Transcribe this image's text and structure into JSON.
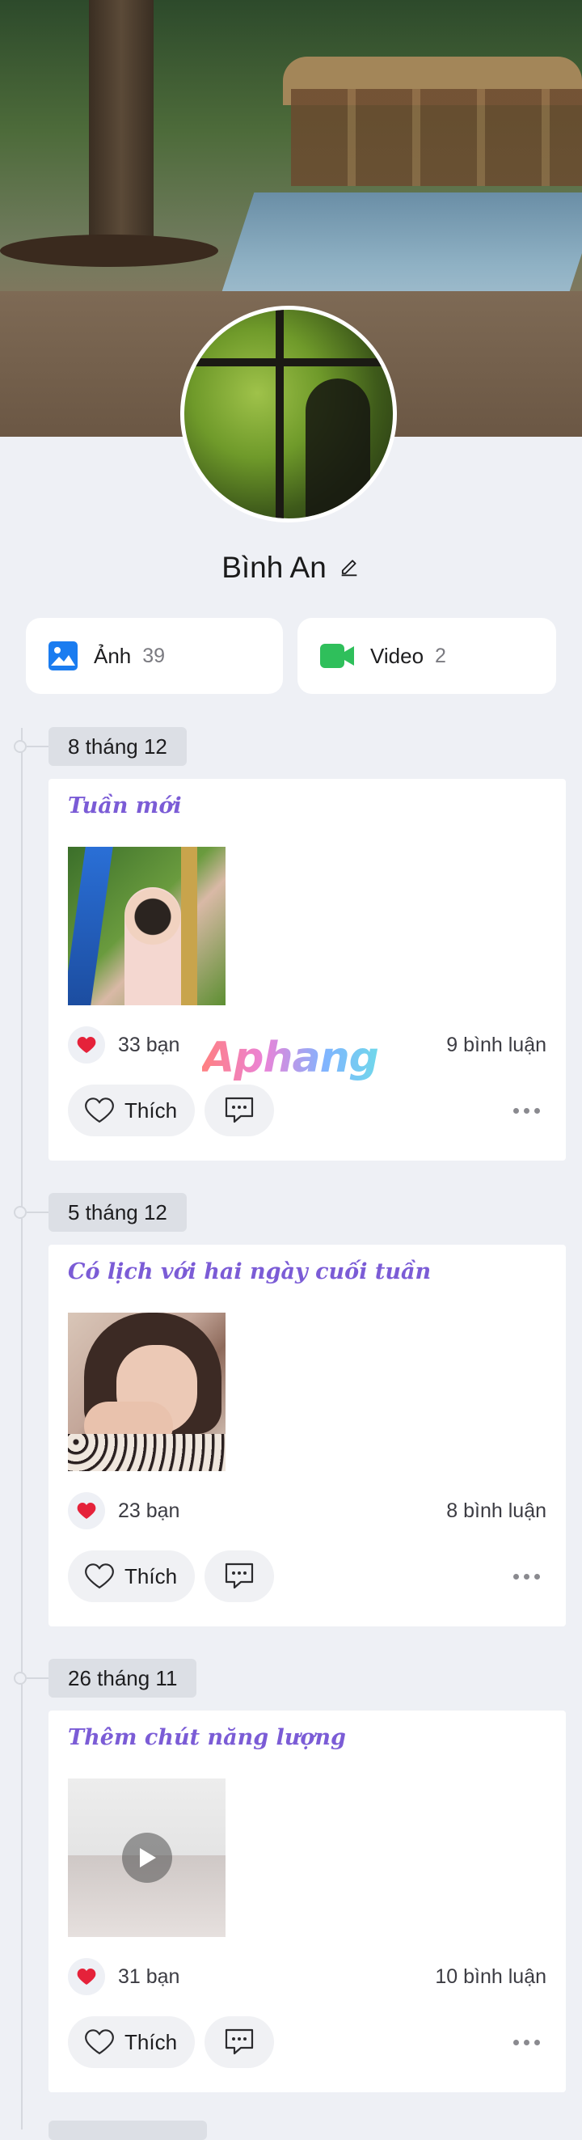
{
  "profile": {
    "name": "Bình An"
  },
  "stats": {
    "photos": {
      "label": "Ảnh",
      "count": "39"
    },
    "videos": {
      "label": "Video",
      "count": "2"
    }
  },
  "watermark": "Aphang",
  "posts": [
    {
      "date": "8 tháng 12",
      "title": "Tuần mới",
      "likes": "33 bạn",
      "comments": "9 bình luận",
      "like_label": "Thích",
      "media": "photo"
    },
    {
      "date": "5 tháng 12",
      "title": "Có lịch với hai ngày cuối tuần",
      "likes": "23 bạn",
      "comments": "8 bình luận",
      "like_label": "Thích",
      "media": "photo"
    },
    {
      "date": "26 tháng 11",
      "title": "Thêm chút năng lượng",
      "likes": "31 bạn",
      "comments": "10 bình luận",
      "like_label": "Thích",
      "media": "video"
    }
  ],
  "icons": {
    "edit": "pencil-icon",
    "photos": "image-icon",
    "videos": "video-camera-icon",
    "heart": "heart-icon",
    "like": "heart-outline-icon",
    "comment": "comment-icon",
    "more": "more-dots-icon",
    "play": "play-icon"
  },
  "colors": {
    "accent_title": "#7b5cd6",
    "photo_icon": "#1a7cf0",
    "video_icon": "#2fbf5b",
    "heart": "#e5223a",
    "background": "#eef0f5"
  }
}
